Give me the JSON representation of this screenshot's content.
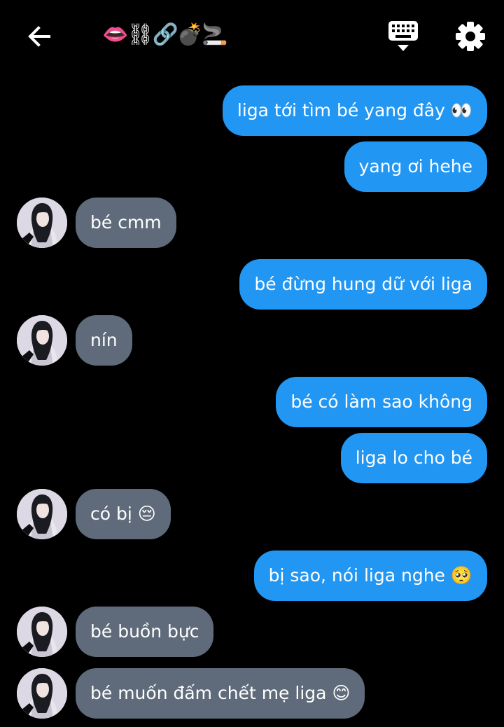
{
  "header": {
    "back_icon": "arrow-left-icon",
    "title": "👄⛓🔗💣🚬",
    "keyboard_icon": "keyboard-icon",
    "settings_icon": "gear-icon"
  },
  "colors": {
    "background": "#000000",
    "outgoing_bubble": "#2196f3",
    "incoming_bubble": "#5f6b7a",
    "text": "#ffffff"
  },
  "messages": [
    {
      "side": "out",
      "text": "liga tới tìm bé yang đây 👀"
    },
    {
      "side": "out",
      "text": "yang ơi hehe"
    },
    {
      "side": "in",
      "text": "bé cmm"
    },
    {
      "side": "out",
      "text": "bé đừng hung dữ với liga"
    },
    {
      "side": "in",
      "text": "nín"
    },
    {
      "side": "out",
      "text": "bé có làm sao không"
    },
    {
      "side": "out",
      "text": "liga lo cho bé"
    },
    {
      "side": "in",
      "text": "có bị 😔"
    },
    {
      "side": "out",
      "text": "bị sao, nói liga nghe 🥺"
    },
    {
      "side": "in",
      "text": "bé buồn bực"
    },
    {
      "side": "in",
      "text": "bé muốn đấm chết mẹ liga 😊"
    }
  ]
}
